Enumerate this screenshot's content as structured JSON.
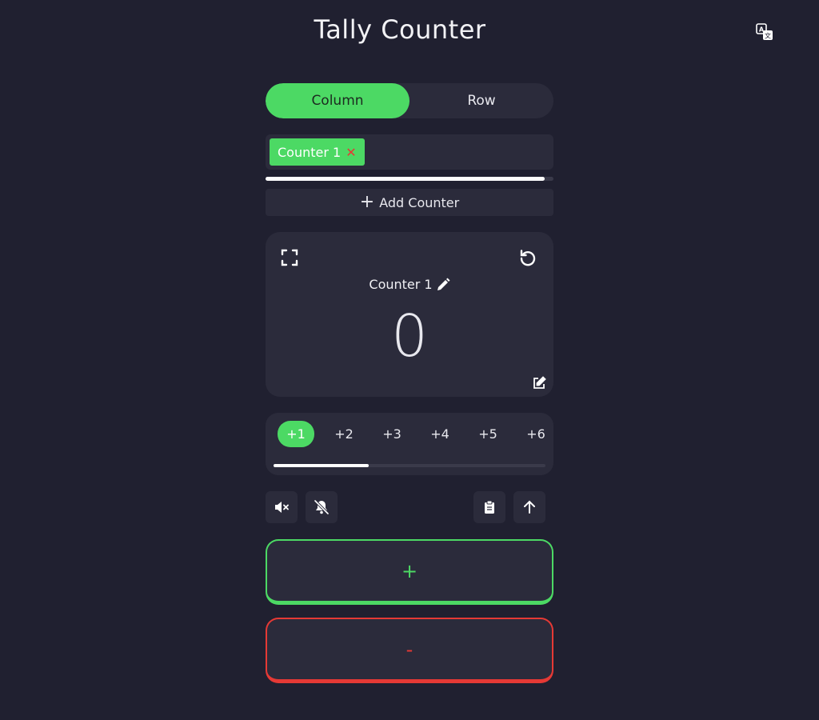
{
  "app": {
    "title": "Tally Counter"
  },
  "layout_toggle": {
    "options": [
      "Column",
      "Row"
    ],
    "active": "Column"
  },
  "tabs": [
    {
      "label": "Counter 1",
      "close": "✕"
    }
  ],
  "tab_scroll_position": 0.97,
  "add_counter": {
    "label": "Add Counter",
    "icon": "+"
  },
  "counter": {
    "name": "Counter 1",
    "value": "0"
  },
  "steps": {
    "options": [
      "+1",
      "+2",
      "+3",
      "+4",
      "+5",
      "+6"
    ],
    "active": "+1",
    "scroll_position": 0.35
  },
  "actions": {
    "increment": "+",
    "decrement": "-"
  },
  "colors": {
    "accent": "#4cd964",
    "danger": "#e53935",
    "background": "#202030",
    "surface": "#2b2b3b"
  },
  "icons": [
    "translate-icon",
    "fullscreen-icon",
    "reset-icon",
    "pencil-icon",
    "edit-value-icon",
    "mute-icon",
    "bell-off-icon",
    "clipboard-icon",
    "arrow-up-icon"
  ]
}
